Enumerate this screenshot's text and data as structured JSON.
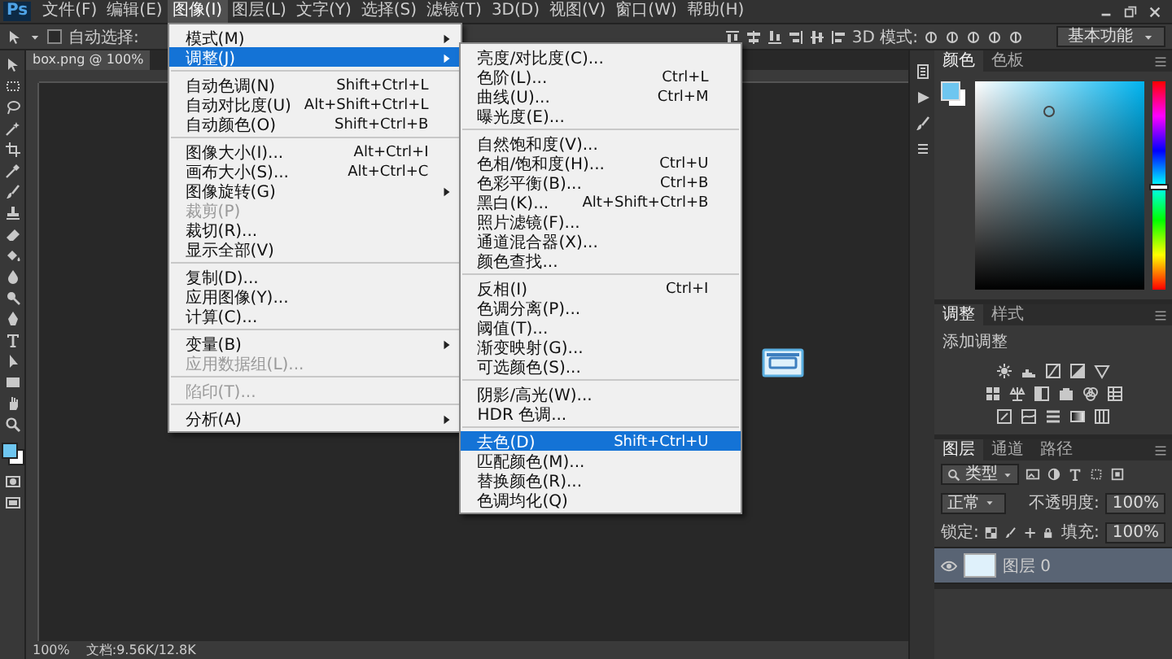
{
  "app_logo": "Ps",
  "menubar": [
    {
      "label": "文件(F)",
      "selected": false
    },
    {
      "label": "编辑(E)",
      "selected": false
    },
    {
      "label": "图像(I)",
      "selected": true
    },
    {
      "label": "图层(L)",
      "selected": false
    },
    {
      "label": "文字(Y)",
      "selected": false
    },
    {
      "label": "选择(S)",
      "selected": false
    },
    {
      "label": "滤镜(T)",
      "selected": false
    },
    {
      "label": "3D(D)",
      "selected": false
    },
    {
      "label": "视图(V)",
      "selected": false
    },
    {
      "label": "窗口(W)",
      "selected": false
    },
    {
      "label": "帮助(H)",
      "selected": false
    }
  ],
  "options_bar": {
    "auto_select": {
      "label": "自动选择:",
      "checked": false
    },
    "mode_label": "3D 模式:",
    "workspace": "基本功能"
  },
  "document_tab": {
    "title": "box.png @ 100%"
  },
  "image_menu": {
    "items": [
      {
        "kind": "item",
        "label": "模式(M)",
        "submenu": true,
        "disabled": false,
        "selected": false
      },
      {
        "kind": "item",
        "label": "调整(J)",
        "submenu": true,
        "disabled": false,
        "selected": true
      },
      {
        "kind": "separator"
      },
      {
        "kind": "item",
        "label": "自动色调(N)",
        "shortcut": "Shift+Ctrl+L",
        "submenu": false,
        "disabled": false,
        "selected": false
      },
      {
        "kind": "item",
        "label": "自动对比度(U)",
        "shortcut": "Alt+Shift+Ctrl+L",
        "submenu": false,
        "disabled": false,
        "selected": false
      },
      {
        "kind": "item",
        "label": "自动颜色(O)",
        "shortcut": "Shift+Ctrl+B",
        "submenu": false,
        "disabled": false,
        "selected": false
      },
      {
        "kind": "separator"
      },
      {
        "kind": "item",
        "label": "图像大小(I)...",
        "shortcut": "Alt+Ctrl+I",
        "submenu": false,
        "disabled": false,
        "selected": false
      },
      {
        "kind": "item",
        "label": "画布大小(S)...",
        "shortcut": "Alt+Ctrl+C",
        "submenu": false,
        "disabled": false,
        "selected": false
      },
      {
        "kind": "item",
        "label": "图像旋转(G)",
        "submenu": true,
        "disabled": false,
        "selected": false
      },
      {
        "kind": "item",
        "label": "裁剪(P)",
        "submenu": false,
        "disabled": true,
        "selected": false
      },
      {
        "kind": "item",
        "label": "裁切(R)...",
        "submenu": false,
        "disabled": false,
        "selected": false
      },
      {
        "kind": "item",
        "label": "显示全部(V)",
        "submenu": false,
        "disabled": false,
        "selected": false
      },
      {
        "kind": "separator"
      },
      {
        "kind": "item",
        "label": "复制(D)...",
        "submenu": false,
        "disabled": false,
        "selected": false
      },
      {
        "kind": "item",
        "label": "应用图像(Y)...",
        "submenu": false,
        "disabled": false,
        "selected": false
      },
      {
        "kind": "item",
        "label": "计算(C)...",
        "submenu": false,
        "disabled": false,
        "selected": false
      },
      {
        "kind": "separator"
      },
      {
        "kind": "item",
        "label": "变量(B)",
        "submenu": true,
        "disabled": false,
        "selected": false
      },
      {
        "kind": "item",
        "label": "应用数据组(L)...",
        "submenu": false,
        "disabled": true,
        "selected": false
      },
      {
        "kind": "separator"
      },
      {
        "kind": "item",
        "label": "陷印(T)...",
        "submenu": false,
        "disabled": true,
        "selected": false
      },
      {
        "kind": "separator"
      },
      {
        "kind": "item",
        "label": "分析(A)",
        "submenu": true,
        "disabled": false,
        "selected": false
      }
    ]
  },
  "adjust_menu": {
    "items": [
      {
        "kind": "item",
        "label": "亮度/对比度(C)...",
        "submenu": false,
        "disabled": false,
        "selected": false
      },
      {
        "kind": "item",
        "label": "色阶(L)...",
        "shortcut": "Ctrl+L",
        "submenu": false,
        "disabled": false,
        "selected": false
      },
      {
        "kind": "item",
        "label": "曲线(U)...",
        "shortcut": "Ctrl+M",
        "submenu": false,
        "disabled": false,
        "selected": false
      },
      {
        "kind": "item",
        "label": "曝光度(E)...",
        "submenu": false,
        "disabled": false,
        "selected": false
      },
      {
        "kind": "separator"
      },
      {
        "kind": "item",
        "label": "自然饱和度(V)...",
        "submenu": false,
        "disabled": false,
        "selected": false
      },
      {
        "kind": "item",
        "label": "色相/饱和度(H)...",
        "shortcut": "Ctrl+U",
        "submenu": false,
        "disabled": false,
        "selected": false
      },
      {
        "kind": "item",
        "label": "色彩平衡(B)...",
        "shortcut": "Ctrl+B",
        "submenu": false,
        "disabled": false,
        "selected": false
      },
      {
        "kind": "item",
        "label": "黑白(K)...",
        "shortcut": "Alt+Shift+Ctrl+B",
        "submenu": false,
        "disabled": false,
        "selected": false
      },
      {
        "kind": "item",
        "label": "照片滤镜(F)...",
        "submenu": false,
        "disabled": false,
        "selected": false
      },
      {
        "kind": "item",
        "label": "通道混合器(X)...",
        "submenu": false,
        "disabled": false,
        "selected": false
      },
      {
        "kind": "item",
        "label": "颜色查找...",
        "submenu": false,
        "disabled": false,
        "selected": false
      },
      {
        "kind": "separator"
      },
      {
        "kind": "item",
        "label": "反相(I)",
        "shortcut": "Ctrl+I",
        "submenu": false,
        "disabled": false,
        "selected": false
      },
      {
        "kind": "item",
        "label": "色调分离(P)...",
        "submenu": false,
        "disabled": false,
        "selected": false
      },
      {
        "kind": "item",
        "label": "阈值(T)...",
        "submenu": false,
        "disabled": false,
        "selected": false
      },
      {
        "kind": "item",
        "label": "渐变映射(G)...",
        "submenu": false,
        "disabled": false,
        "selected": false
      },
      {
        "kind": "item",
        "label": "可选颜色(S)...",
        "submenu": false,
        "disabled": false,
        "selected": false
      },
      {
        "kind": "separator"
      },
      {
        "kind": "item",
        "label": "阴影/高光(W)...",
        "submenu": false,
        "disabled": false,
        "selected": false
      },
      {
        "kind": "item",
        "label": "HDR 色调...",
        "submenu": false,
        "disabled": false,
        "selected": false
      },
      {
        "kind": "separator"
      },
      {
        "kind": "item",
        "label": "去色(D)",
        "shortcut": "Shift+Ctrl+U",
        "submenu": false,
        "disabled": false,
        "selected": true
      },
      {
        "kind": "item",
        "label": "匹配颜色(M)...",
        "submenu": false,
        "disabled": false,
        "selected": false
      },
      {
        "kind": "item",
        "label": "替换颜色(R)...",
        "submenu": false,
        "disabled": false,
        "selected": false
      },
      {
        "kind": "item",
        "label": "色调均化(Q)",
        "submenu": false,
        "disabled": false,
        "selected": false
      }
    ]
  },
  "color_panel": {
    "tabs": [
      {
        "label": "颜色",
        "selected": true
      },
      {
        "label": "色板",
        "selected": false
      }
    ],
    "hue": {
      "level": 0.5
    }
  },
  "adjustments_panel": {
    "tabs": [
      {
        "label": "调整",
        "selected": true
      },
      {
        "label": "样式",
        "selected": false
      }
    ],
    "title": "添加调整"
  },
  "layers_panel": {
    "tabs": [
      {
        "label": "图层",
        "selected": true
      },
      {
        "label": "通道",
        "selected": false
      },
      {
        "label": "路径",
        "selected": false
      }
    ],
    "filter": "类型",
    "blend_mode": "正常",
    "opacity_label": "不透明度:",
    "opacity": "100%",
    "lock_label": "锁定:",
    "fill_label": "填充:",
    "fill": "100%",
    "layers": [
      {
        "name": "图层 0",
        "selected": true,
        "visible": true
      }
    ]
  },
  "status_bar": {
    "zoom": "100%",
    "doc_info": "文档:9.56K/12.8K"
  }
}
